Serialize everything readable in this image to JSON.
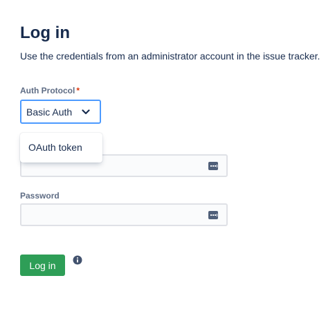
{
  "header": {
    "title": "Log in",
    "subtitle": "Use the credentials from an administrator account in the issue tracker."
  },
  "auth_protocol": {
    "label": "Auth Protocol",
    "required_marker": "*",
    "selected": "Basic Auth",
    "options_visible": [
      "OAuth token"
    ],
    "icon": "chevron-down-icon"
  },
  "username": {
    "value": "",
    "icon": "password-manager-icon"
  },
  "password": {
    "label": "Password",
    "value": "",
    "icon": "password-manager-icon"
  },
  "actions": {
    "login_label": "Log in",
    "info_icon": "info-icon"
  },
  "colors": {
    "primary_text": "#172b4d",
    "label_text": "#5e6c84",
    "required": "#de350b",
    "focus_border": "#4c9aff",
    "button": "#2e9e57",
    "input_bg": "#fafbfc",
    "input_border": "#dfe1e6"
  }
}
